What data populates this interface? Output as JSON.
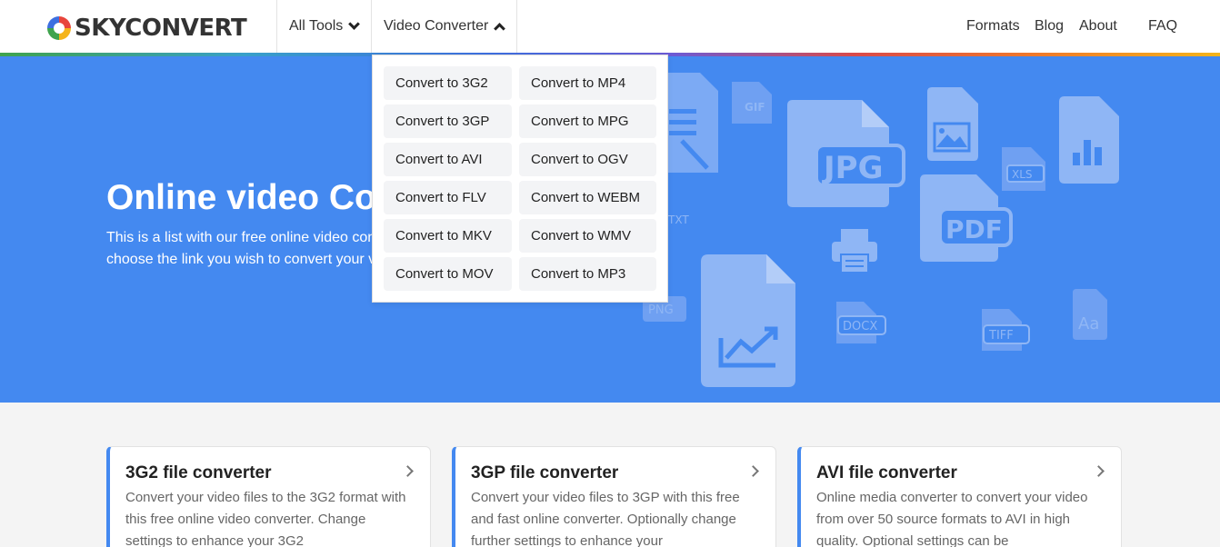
{
  "header": {
    "logo_text": "SKYCONVERT",
    "nav": {
      "all_tools": "All Tools",
      "video_converter": "Video Converter",
      "formats": "Formats",
      "blog": "Blog",
      "about": "About",
      "faq": "FAQ"
    }
  },
  "hero": {
    "title": "Online video Converter",
    "desc_line1": "This is a list with our free online video converters. Simply",
    "desc_line2": "choose the link you wish to convert your video files."
  },
  "dropdown": {
    "col1": [
      "Convert to 3G2",
      "Convert to 3GP",
      "Convert to AVI",
      "Convert to FLV",
      "Convert to MKV",
      "Convert to MOV"
    ],
    "col2": [
      "Convert to MP4",
      "Convert to MPG",
      "Convert to OGV",
      "Convert to WEBM",
      "Convert to WMV",
      "Convert to MP3"
    ]
  },
  "hero_icons": [
    "gif",
    "jpg",
    "image",
    "xls",
    "chart",
    "pdf",
    "txt",
    "printer",
    "png",
    "line-chart",
    "docx",
    "tiff",
    "aa-font"
  ],
  "hero_icon_labels": {
    "gif": "GIF",
    "jpg": "JPG",
    "xls": "XLS",
    "pdf": "PDF",
    "txt": "TXT",
    "png": "PNG",
    "docx": "DOCX",
    "tiff": "TIFF",
    "aa": "Aa"
  },
  "cards": [
    {
      "title": "3G2 file converter",
      "desc": "Convert your video files to the 3G2 format with this free online video converter. Change settings to enhance your 3G2"
    },
    {
      "title": "3GP file converter",
      "desc": "Convert your video files to 3GP with this free and fast online converter. Optionally change further settings to enhance your"
    },
    {
      "title": "AVI file converter",
      "desc": "Online media converter to convert your video from over 50 source formats to AVI in high quality. Optional settings can be"
    }
  ],
  "colors": {
    "hero_bg": "#4489f0",
    "accent": "#4489f0",
    "icon_fill": "#8fb6f5"
  }
}
